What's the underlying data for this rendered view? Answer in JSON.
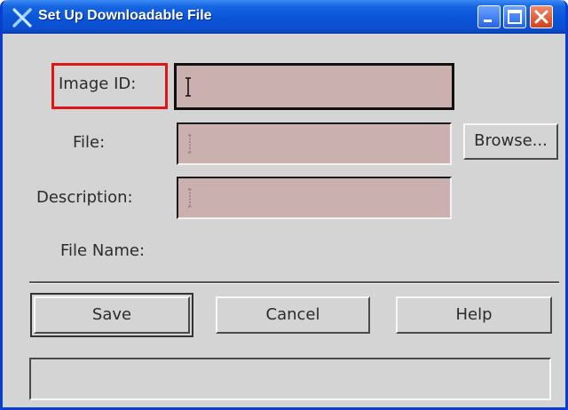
{
  "window": {
    "title": "Set Up Downloadable File",
    "app_icon": "x-icon",
    "controls": [
      "minimize-icon",
      "maximize-icon",
      "close-icon"
    ]
  },
  "form": {
    "image_id": {
      "label": "Image ID:",
      "value": ""
    },
    "file": {
      "label": "File:",
      "value": ""
    },
    "description": {
      "label": "Description:",
      "value": ""
    },
    "file_name": {
      "label": "File Name:",
      "value": ""
    }
  },
  "buttons": {
    "browse": "Browse...",
    "save": "Save",
    "cancel": "Cancel",
    "help": "Help"
  },
  "status": {
    "text": ""
  },
  "colors": {
    "titlebar": "#0a54d8",
    "field_bg": "#cbb0b0",
    "highlight": "#e01515",
    "window_bg": "#d4d4d4"
  }
}
